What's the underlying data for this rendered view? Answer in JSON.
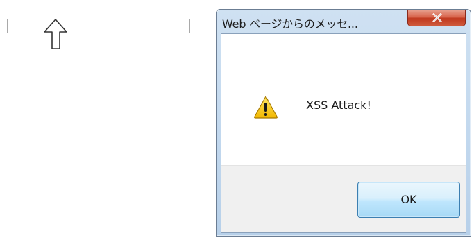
{
  "page": {
    "input_value": ""
  },
  "dialog": {
    "title": "Web ページからのメッセ...",
    "message": "XSS Attack!",
    "ok_label": "OK",
    "close_icon": "close-icon",
    "message_icon": "warning-icon",
    "cursor_icon": "arrow-pointer-icon"
  },
  "colors": {
    "close_button": "#c7452b",
    "ok_button_border": "#3c7fb1",
    "warning_yellow": "#f5c400",
    "dialog_frame": "#c2d8ee"
  }
}
